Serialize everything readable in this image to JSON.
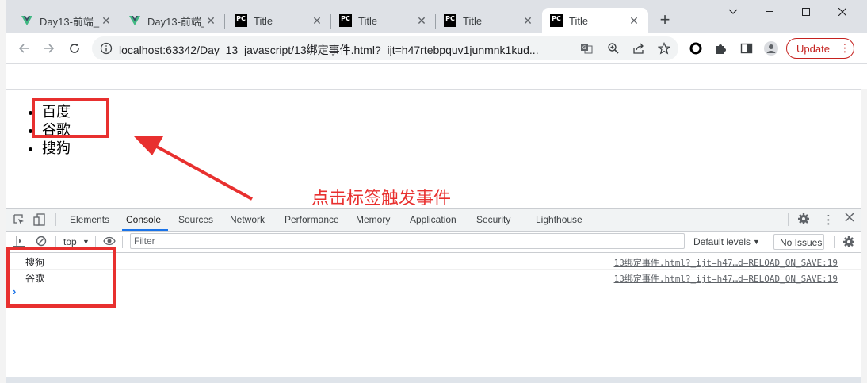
{
  "tabs": [
    {
      "label": "Day13-前端_",
      "icon": "vue-icon",
      "active": false
    },
    {
      "label": "Day13-前端_",
      "icon": "vue-icon",
      "active": false
    },
    {
      "label": "Title",
      "icon": "pycharm-icon",
      "active": false
    },
    {
      "label": "Title",
      "icon": "pycharm-icon",
      "active": false
    },
    {
      "label": "Title",
      "icon": "pycharm-icon",
      "active": false
    },
    {
      "label": "Title",
      "icon": "pycharm-icon",
      "active": true
    }
  ],
  "pc_badge": "PC",
  "new_tab_symbol": "+",
  "toolbar": {
    "url": "localhost:63342/Day_13_javascript/13绑定事件.html?_ijt=h47rtebpquv1junmnk1kud...",
    "update_label": "Update"
  },
  "page": {
    "list_items": [
      "百度",
      "谷歌",
      "搜狗"
    ]
  },
  "annotation": "点击标签触发事件",
  "devtools": {
    "tabs": [
      "Elements",
      "Console",
      "Sources",
      "Network",
      "Performance",
      "Memory",
      "Application",
      "Security",
      "Lighthouse"
    ],
    "active_tab": "Console",
    "context": "top",
    "filter_placeholder": "Filter",
    "levels_label": "Default levels",
    "issues_label": "No Issues",
    "logs": [
      {
        "message": "搜狗",
        "source": "13绑定事件.html?_ijt=h47…d=RELOAD_ON_SAVE:19"
      },
      {
        "message": "谷歌",
        "source": "13绑定事件.html?_ijt=h47…d=RELOAD_ON_SAVE:19"
      }
    ],
    "prompt": "›"
  },
  "colors": {
    "accent": "#1a73e8",
    "annotation_red": "#e8302f",
    "update_red": "#c5221f"
  }
}
